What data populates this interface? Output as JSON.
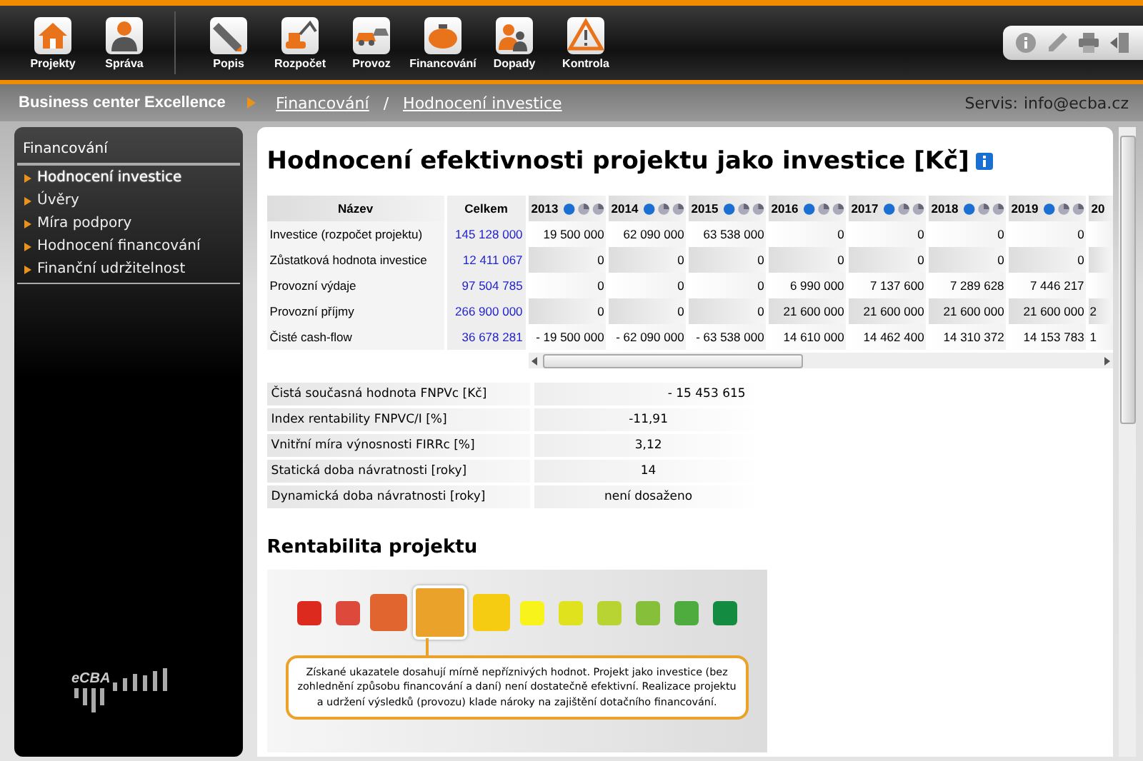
{
  "nav": {
    "left": [
      {
        "label": "Projekty"
      },
      {
        "label": "Správa"
      }
    ],
    "main": [
      {
        "label": "Popis"
      },
      {
        "label": "Rozpočet"
      },
      {
        "label": "Provoz"
      },
      {
        "label": "Financování"
      },
      {
        "label": "Dopady"
      },
      {
        "label": "Kontrola"
      }
    ]
  },
  "breadcrumb": {
    "project": "Business center Excellence",
    "items": [
      "Financování",
      "Hodnocení investice"
    ],
    "separator": "/",
    "service_label": "Servis:",
    "service_email": "info@ecba.cz"
  },
  "sidebar": {
    "heading": "Financování",
    "items": [
      {
        "label": "Hodnocení investice",
        "selected": true
      },
      {
        "label": "Úvěry",
        "selected": false
      },
      {
        "label": "Míra podpory",
        "selected": false
      },
      {
        "label": "Hodnocení financování",
        "selected": false
      },
      {
        "label": "Finanční udržitelnost",
        "selected": false
      }
    ],
    "logo": "eCBA"
  },
  "title": "Hodnocení efektivnosti projektu jako investice [Kč]",
  "table": {
    "name_header": "Název",
    "total_header": "Celkem",
    "years": [
      "2013",
      "2014",
      "2015",
      "2016",
      "2017",
      "2018",
      "2019",
      "20"
    ],
    "rows": [
      {
        "name": "Investice (rozpočet projektu)",
        "total": "145 128 000",
        "values": [
          "19 500 000",
          "62 090 000",
          "63 538 000",
          "0",
          "0",
          "0",
          "0"
        ]
      },
      {
        "name": "Zůstatková hodnota investice",
        "total": "12 411 067",
        "values": [
          "0",
          "0",
          "0",
          "0",
          "0",
          "0",
          "0"
        ]
      },
      {
        "name": "Provozní výdaje",
        "total": "97 504 785",
        "values": [
          "0",
          "0",
          "0",
          "6 990 000",
          "7 137 600",
          "7 289 628",
          "7 446 217"
        ]
      },
      {
        "name": "Provozní příjmy",
        "total": "266 900 000",
        "values": [
          "0",
          "0",
          "0",
          "21 600 000",
          "21 600 000",
          "21 600 000",
          "21 600 000",
          "2"
        ]
      },
      {
        "name": "Čisté cash-flow",
        "total": "36 678 281",
        "values": [
          "- 19 500 000",
          "- 62 090 000",
          "- 63 538 000",
          "14 610 000",
          "14 462 400",
          "14 310 372",
          "14 153 783",
          "1"
        ]
      }
    ]
  },
  "summary": [
    {
      "label": "Čistá současná hodnota FNPVc [Kč]",
      "value": "- 15 453 615"
    },
    {
      "label": "Index rentability FNPVC/I [%]",
      "value": "-11,91"
    },
    {
      "label": "Vnitřní míra výnosnosti FIRRc [%]",
      "value": "3,12"
    },
    {
      "label": "Statická doba návratnosti [roky]",
      "value": "14"
    },
    {
      "label": "Dynamická doba návratnosti [roky]",
      "value": "není dosaženo"
    }
  ],
  "rating": {
    "heading": "Rentabilita projektu",
    "scale": [
      {
        "color": "#dc2a1e",
        "selected": false
      },
      {
        "color": "#dd4a3c",
        "selected": false
      },
      {
        "color": "#e0652f",
        "selected": false
      },
      {
        "color": "#eba22a",
        "selected": true
      },
      {
        "color": "#f5cc12",
        "selected": false
      },
      {
        "color": "#f8f31a",
        "selected": false
      },
      {
        "color": "#dfe21c",
        "selected": false
      },
      {
        "color": "#b8d433",
        "selected": false
      },
      {
        "color": "#86c03b",
        "selected": false
      },
      {
        "color": "#4eab3e",
        "selected": false
      },
      {
        "color": "#138c42",
        "selected": false
      }
    ],
    "text": "Získané ukazatele dosahují mírně nepříznivých hodnot. Projekt jako investice (bez zohlednění způsobu financování a daní) není dostatečně efektivní. Realizace projektu a udržení výsledků (provozu) klade nároky na zajištění dotačního financování."
  }
}
